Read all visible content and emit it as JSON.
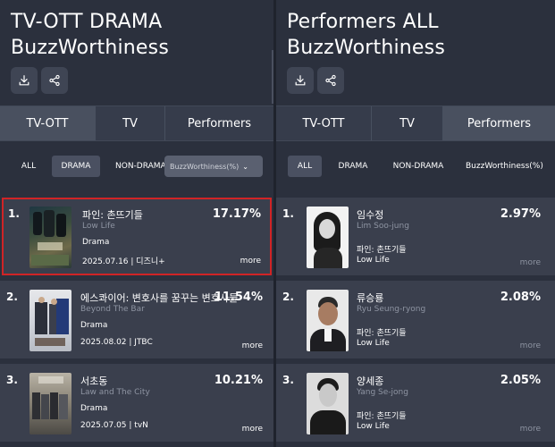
{
  "left": {
    "title_line1": "TV-OTT DRAMA",
    "title_line2": "BuzzWorthiness",
    "tabs": [
      {
        "label": "TV-OTT",
        "active": true
      },
      {
        "label": "TV",
        "active": false
      },
      {
        "label": "Performers",
        "active": false
      }
    ],
    "filters": [
      "ALL",
      "DRAMA",
      "NON-DRAMA"
    ],
    "active_filter": "DRAMA",
    "select_value": "BuzzWorthiness(%)",
    "items": [
      {
        "rank": "1.",
        "title": "파인: 촌뜨기들",
        "subtitle": "Low Life",
        "genre": "Drama",
        "meta": "2025.07.16 | 디즈니+",
        "pct": "17.17%",
        "more": "more"
      },
      {
        "rank": "2.",
        "title": "에스콰이어: 변호사를 꿈꾸는 변호사들",
        "subtitle": "Beyond The Bar",
        "genre": "Drama",
        "meta": "2025.08.02 | JTBC",
        "pct": "11.54%",
        "more": "more"
      },
      {
        "rank": "3.",
        "title": "서초동",
        "subtitle": "Law and The City",
        "genre": "Drama",
        "meta": "2025.07.05 | tvN",
        "pct": "10.21%",
        "more": "more"
      }
    ]
  },
  "right": {
    "title_line1": "Performers ALL",
    "title_line2": "BuzzWorthiness",
    "tabs": [
      {
        "label": "TV-OTT",
        "active": false
      },
      {
        "label": "TV",
        "active": false
      },
      {
        "label": "Performers",
        "active": true
      }
    ],
    "filters": [
      "ALL",
      "DRAMA",
      "NON-DRAMA"
    ],
    "active_filter": "ALL",
    "select_value": "BuzzWorthiness(%)",
    "items": [
      {
        "rank": "1.",
        "name": "임수정",
        "name_en": "Lim Soo-jung",
        "work_kr": "파인: 촌뜨기들",
        "work_en": "Low Life",
        "pct": "2.97%",
        "more": "more"
      },
      {
        "rank": "2.",
        "name": "류승룡",
        "name_en": "Ryu Seung-ryong",
        "work_kr": "파인: 촌뜨기들",
        "work_en": "Low Life",
        "pct": "2.08%",
        "more": "more"
      },
      {
        "rank": "3.",
        "name": "양세종",
        "name_en": "Yang Se-jong",
        "work_kr": "파인: 촌뜨기들",
        "work_en": "Low Life",
        "pct": "2.05%",
        "more": "more"
      }
    ]
  },
  "icons": {
    "download": "download-icon",
    "share": "share-icon",
    "chevron": "chevron-down-icon"
  },
  "colors": {
    "background": "#2b303d",
    "card": "#3a3f4d",
    "tab_active": "#49505f",
    "highlight_border": "#d02426"
  }
}
